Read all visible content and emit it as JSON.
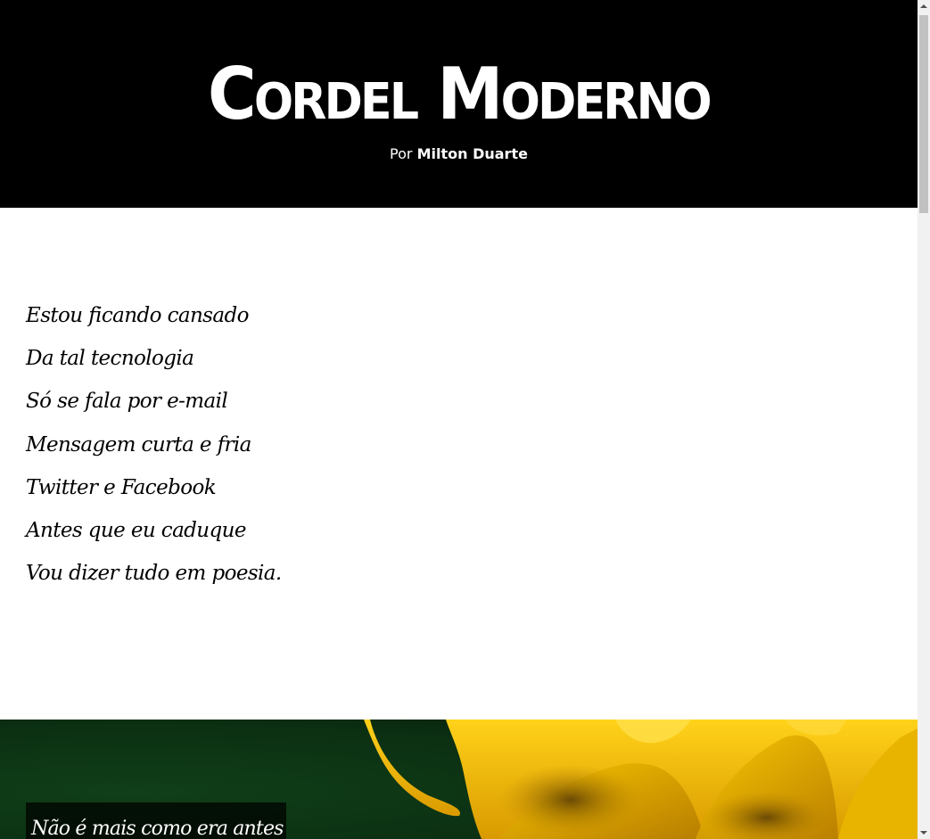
{
  "header": {
    "title": "Cordel Moderno",
    "byline_prefix": "Por",
    "author": "Milton Duarte"
  },
  "poem": {
    "lines": [
      "Estou ficando cansado",
      "Da tal tecnologia",
      "Só se fala por e-mail",
      "Mensagem curta e fria",
      "Twitter e Facebook",
      "Antes que eu caduque",
      "Vou dizer tudo em poesia."
    ]
  },
  "flower_section": {
    "caption": "Não é mais como era antes"
  },
  "colors": {
    "header_bg": "#000000",
    "header_text": "#ffffff",
    "body_bg": "#ffffff",
    "poem_text": "#000000",
    "flower_yellow": "#f5c400",
    "foliage_green": "#0c3514"
  },
  "scrollbar": {
    "position_fraction": 0
  }
}
